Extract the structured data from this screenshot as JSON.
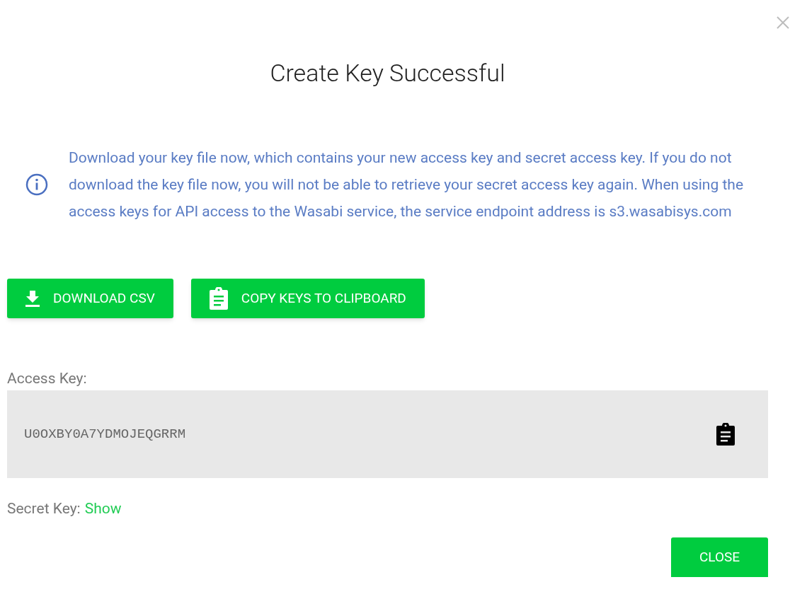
{
  "dialog": {
    "title": "Create Key Successful",
    "info": "Download your key file now, which contains your new access key and secret access key. If you do not download the key file now, you will not be able to retrieve your secret access key again. When using the access keys for API access to the Wasabi service, the service endpoint address is s3.wasabisys.com",
    "actions": [
      {
        "kind": "download",
        "label": "DOWNLOAD CSV"
      },
      {
        "kind": "copy",
        "label": "COPY KEYS TO CLIPBOARD"
      }
    ],
    "access_key": {
      "label": "Access Key:",
      "value": "U0OXBY0A7YDMOJEQGRRM"
    },
    "secret_key": {
      "label": "Secret Key:",
      "link": "Show"
    },
    "close_button": "CLOSE"
  }
}
